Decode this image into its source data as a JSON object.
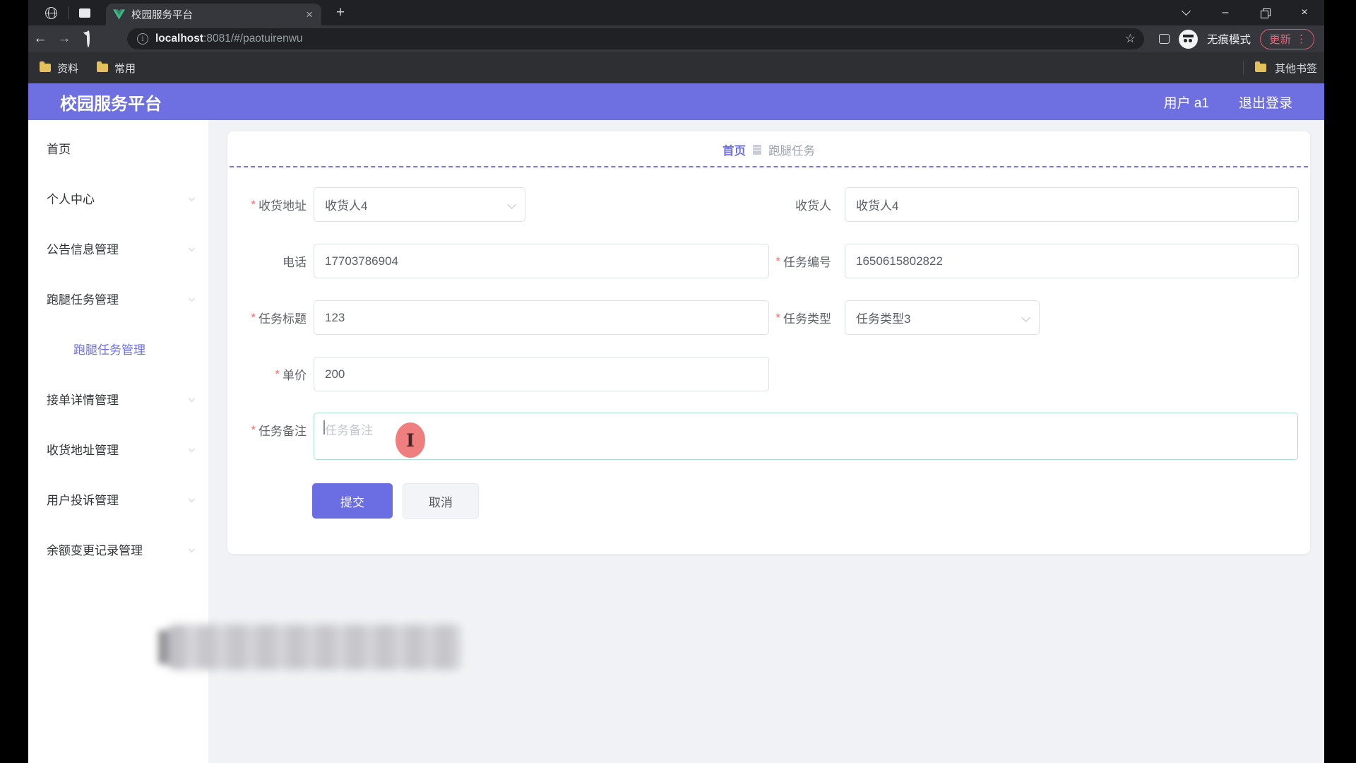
{
  "window": {
    "tab_title": "校园服务平台"
  },
  "icons": {
    "close": "×",
    "plus": "+",
    "back": "←",
    "forward": "→",
    "star": "☆",
    "dots": "⋮",
    "minimize": "–",
    "info": "i"
  },
  "browser": {
    "url_host": "localhost",
    "url_path": ":8081/#/paotuirenwu",
    "incognito_label": "无痕模式",
    "update_label": "更新",
    "bookmarks_left": [
      "资料",
      "常用"
    ],
    "bookmarks_right": "其他书签"
  },
  "app_header": {
    "brand": "校园服务平台",
    "user": "用户 a1",
    "logout": "退出登录"
  },
  "sidebar": {
    "items": [
      {
        "label": "首页"
      },
      {
        "label": "个人中心"
      },
      {
        "label": "公告信息管理"
      },
      {
        "label": "跑腿任务管理"
      },
      {
        "label": "跑腿任务管理",
        "sub": true,
        "active": true
      },
      {
        "label": "接单详情管理"
      },
      {
        "label": "收货地址管理"
      },
      {
        "label": "用户投诉管理"
      },
      {
        "label": "余额变更记录管理"
      }
    ]
  },
  "breadcrumb": {
    "home": "首页",
    "current": "跑腿任务"
  },
  "form": {
    "fields": [
      {
        "label": "收货地址",
        "mark": "*",
        "value": "收货人4",
        "kind": "select"
      },
      {
        "label": "收货人",
        "mark": "",
        "value": "收货人4",
        "kind": "input"
      },
      {
        "label": "电话",
        "mark": "",
        "value": "17703786904",
        "kind": "input"
      },
      {
        "label": "任务编号",
        "mark": "*",
        "value": "1650615802822",
        "kind": "input"
      },
      {
        "label": "任务标题",
        "mark": "*",
        "value": "123",
        "kind": "input"
      },
      {
        "label": "任务类型",
        "mark": "*",
        "value": "任务类型3",
        "kind": "select"
      },
      {
        "label": "单价",
        "mark": "*",
        "value": "200",
        "kind": "input"
      },
      {
        "label": "任务备注",
        "mark": "*",
        "value": "",
        "placeholder": "任务备注",
        "kind": "textarea"
      }
    ],
    "submit_label": "提交",
    "cancel_label": "取消"
  },
  "colors": {
    "accent_purple": "#6e70e1",
    "required_red": "#f56c6c",
    "update_red": "#d95d6e",
    "textarea_focus_border": "#a9dcd2",
    "folder_yellow": "#e4c05c",
    "content_bg": "#f0f2f5"
  }
}
